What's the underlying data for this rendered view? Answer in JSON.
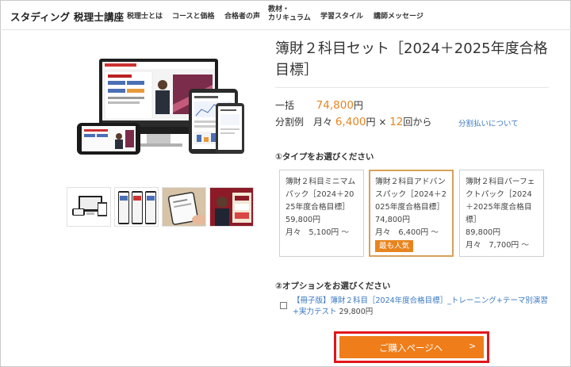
{
  "header": {
    "logo": "スタディング 税理士講座",
    "nav": [
      {
        "label": "税理士とは"
      },
      {
        "label": "コースと価格"
      },
      {
        "label": "合格者の声"
      },
      {
        "label_line1": "教材・",
        "label_line2": "カリキュラム"
      },
      {
        "label": "学習スタイル"
      },
      {
        "label": "講師メッセージ"
      }
    ]
  },
  "product": {
    "title": "簿財２科目セット［2024＋2025年度合格目標］",
    "lump_sum_label": "一括",
    "lump_sum_price": "74,800",
    "yen": "円",
    "installment_label": "分割例　月々",
    "installment_monthly": "6,400",
    "installment_times_prefix": "円 × ",
    "installment_count": "12",
    "installment_suffix": "回から",
    "installment_link": "分割払いについて"
  },
  "type_section": {
    "label": "①タイプをお選びください",
    "cards": [
      {
        "name": "簿財２科目ミニマムパック［2024＋2025年度合格目標］",
        "price": "59,800円",
        "monthly": "月々　5,100円 〜",
        "selected": false
      },
      {
        "name": "簿財２科目アドバンスパック［2024＋2025年度合格目標］",
        "price": "74,800円",
        "monthly": "月々　6,400円 〜",
        "selected": true,
        "badge": "最も人気"
      },
      {
        "name": "簿財２科目パーフェクトパック［2024＋2025年度合格目標］",
        "price": "89,800円",
        "monthly": "月々　7,700円 〜",
        "selected": false
      }
    ]
  },
  "option_section": {
    "label": "②オプションをお選びください",
    "item_text": "【冊子版】簿財２科目［2024年度合格目標］_トレーニング+テーマ別演習+実力テスト",
    "item_price": "29,800円",
    "checked": false
  },
  "cta": {
    "label": "ご購入ページへ",
    "arrow": ">"
  },
  "icons": {
    "option_checkbox": "checkbox-icon",
    "cta_arrow": "chevron-right-icon"
  },
  "colors": {
    "accent_orange": "#e8841f",
    "button_orange": "#ef7d1a",
    "highlight_red": "#e0171b",
    "link_blue": "#3a78c2",
    "selected_border": "#d9a05b"
  }
}
